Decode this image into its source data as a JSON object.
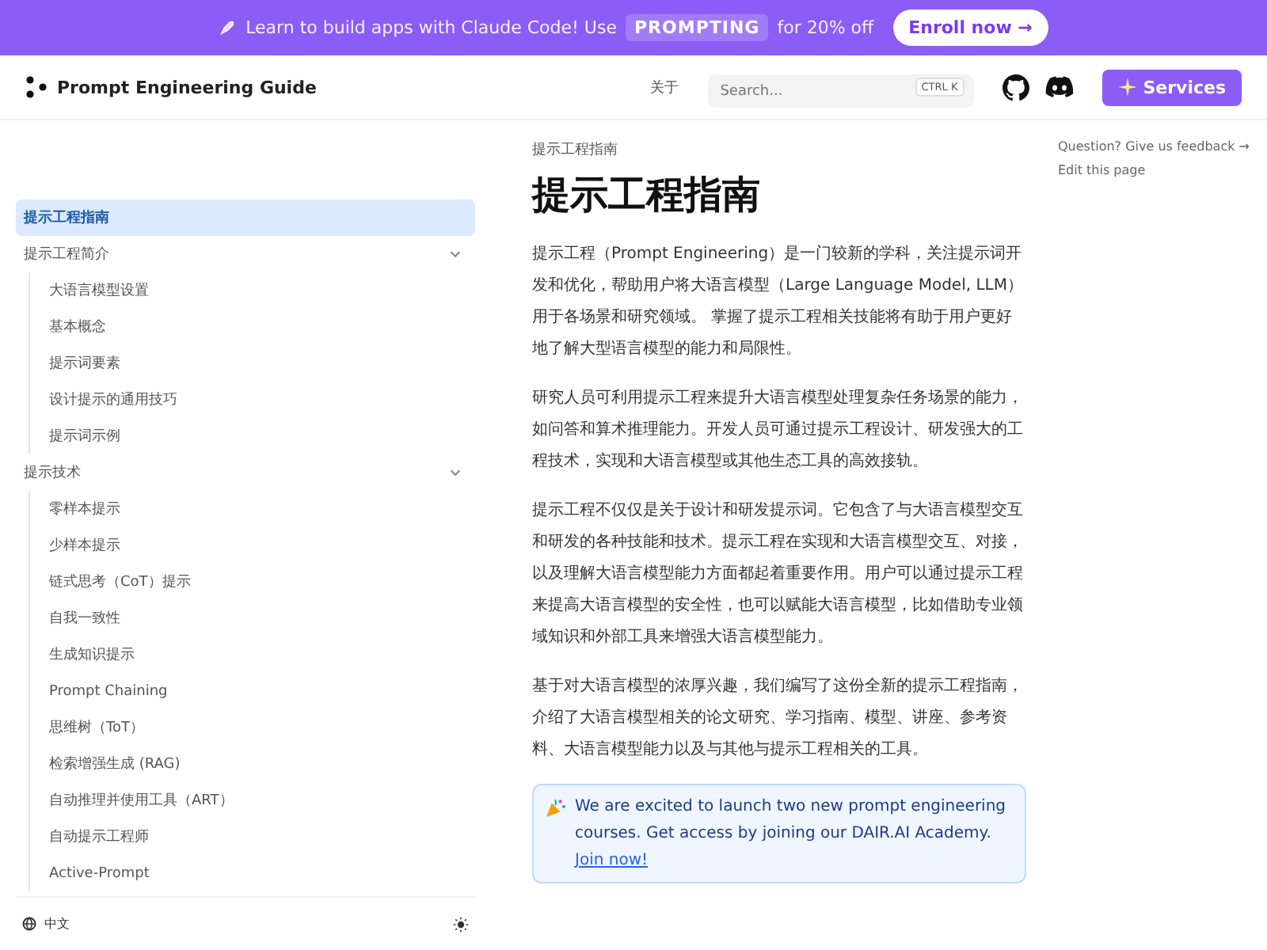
{
  "banner": {
    "text_before": "Learn to build apps with Claude Code! Use",
    "code": "PROMPTING",
    "text_after": "for 20% off",
    "button": "Enroll now →"
  },
  "header": {
    "logo": "Prompt Engineering Guide",
    "nav": "关于",
    "search": {
      "placeholder": "Search..."
    },
    "shortcut": "CTRL K",
    "services": "Services"
  },
  "sidebar": {
    "items": [
      {
        "kind": "link",
        "label": "提示工程指南",
        "selected": true
      },
      {
        "kind": "group",
        "label": "提示工程简介",
        "expanded": true,
        "children": [
          {
            "label": "大语言模型设置",
            "selected": false
          },
          {
            "label": "基本概念",
            "selected": false
          },
          {
            "label": "提示词要素",
            "selected": false
          },
          {
            "label": "设计提示的通用技巧",
            "selected": false
          },
          {
            "label": "提示词示例",
            "selected": false
          }
        ]
      },
      {
        "kind": "group",
        "label": "提示技术",
        "expanded": true,
        "children": [
          {
            "label": "零样本提示",
            "selected": false
          },
          {
            "label": "少样本提示",
            "selected": false
          },
          {
            "label": "链式思考（CoT）提示",
            "selected": false
          },
          {
            "label": "自我一致性",
            "selected": false
          },
          {
            "label": "生成知识提示",
            "selected": false
          },
          {
            "label": "Prompt Chaining",
            "selected": false
          },
          {
            "label": "思维树（ToT）",
            "selected": false
          },
          {
            "label": "检索增强生成 (RAG)",
            "selected": false
          },
          {
            "label": "自动推理并使用工具（ART）",
            "selected": false
          },
          {
            "label": "自动提示工程师",
            "selected": false
          },
          {
            "label": "Active-Prompt",
            "selected": false
          }
        ]
      }
    ],
    "language": "中文"
  },
  "article": {
    "breadcrumb": "提示工程指南",
    "title": "提示工程指南",
    "paragraphs": [
      "提示工程（Prompt Engineering）是一门较新的学科，关注提示词开发和优化，帮助用户将大语言模型（Large Language Model, LLM）用于各场景和研究领域。 掌握了提示工程相关技能将有助于用户更好地了解大型语言模型的能力和局限性。",
      "研究人员可利用提示工程来提升大语言模型处理复杂任务场景的能力，如问答和算术推理能力。开发人员可通过提示工程设计、研发强大的工程技术，实现和大语言模型或其他生态工具的高效接轨。",
      "提示工程不仅仅是关于设计和研发提示词。它包含了与大语言模型交互和研发的各种技能和技术。提示工程在实现和大语言模型交互、对接，以及理解大语言模型能力方面都起着重要作用。用户可以通过提示工程来提高大语言模型的安全性，也可以赋能大语言模型，比如借助专业领域知识和外部工具来增强大语言模型能力。",
      "基于对大语言模型的浓厚兴趣，我们编写了这份全新的提示工程指南，介绍了大语言模型相关的论文研究、学习指南、模型、讲座、参考资料、大语言模型能力以及与其他与提示工程相关的工具。"
    ],
    "callout": {
      "text": "We are excited to launch two new prompt engineering courses. Get access by joining our DAIR.AI Academy.",
      "link": "Join now!"
    }
  },
  "toc": {
    "feedback": "Question? Give us feedback →",
    "edit": "Edit this page"
  }
}
